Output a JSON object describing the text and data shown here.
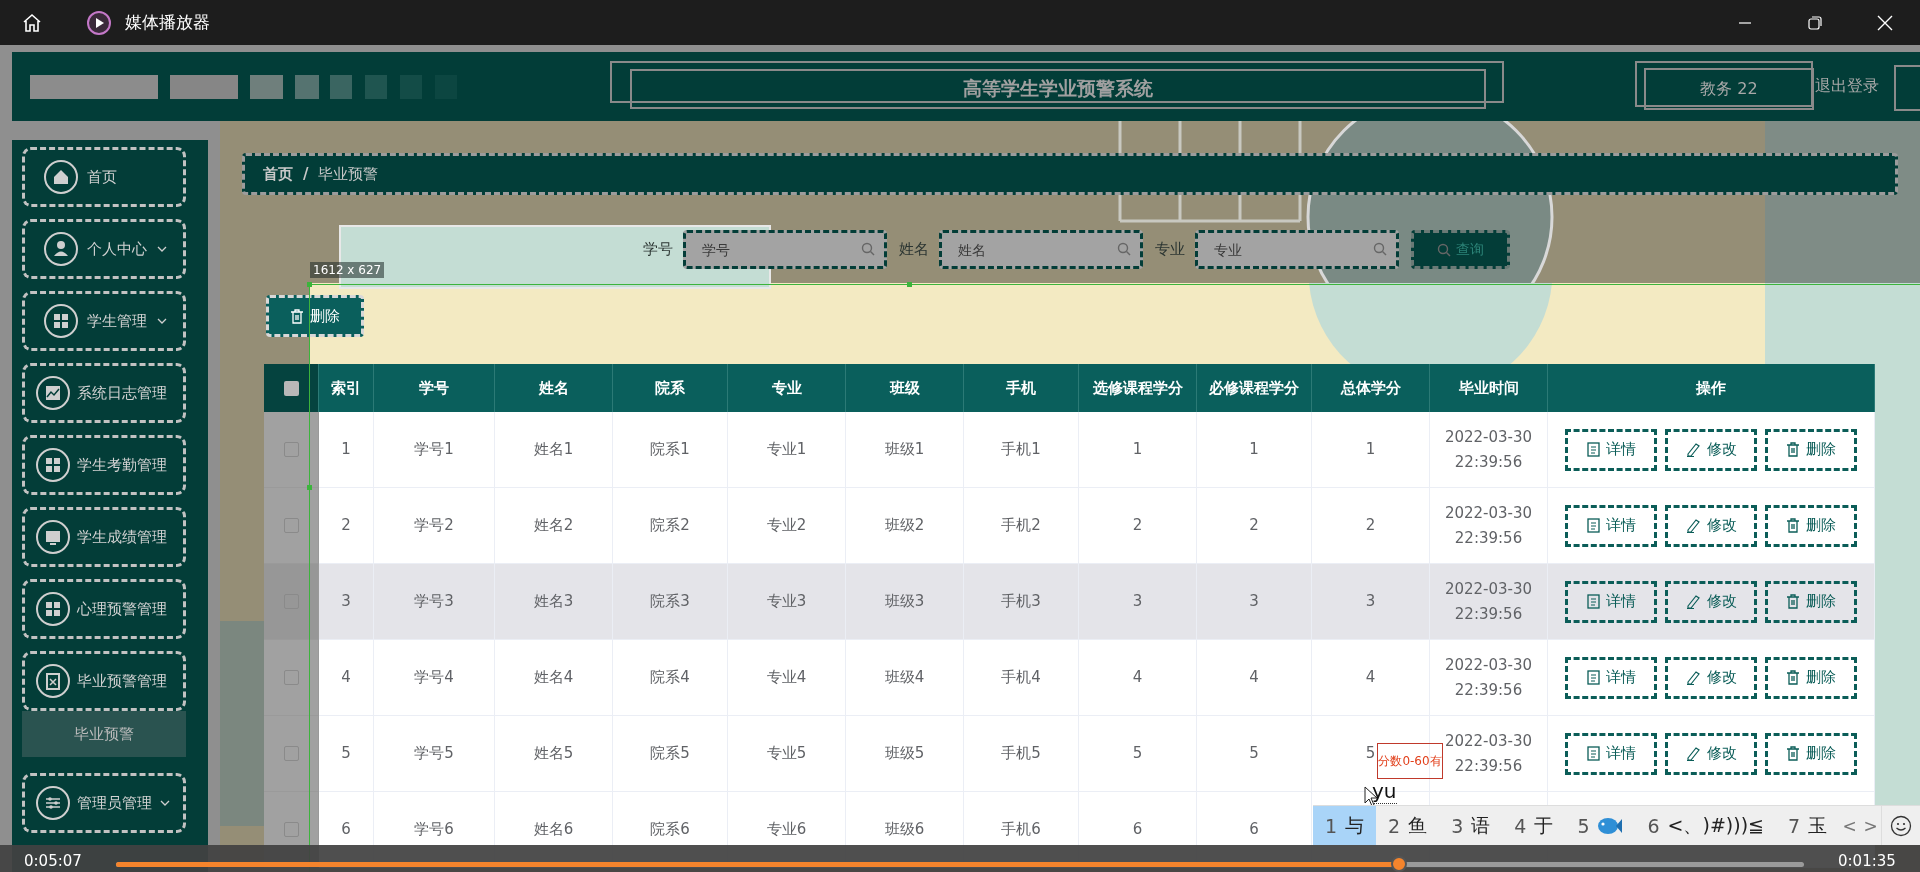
{
  "title_bar": {
    "title": "媒体播放器"
  },
  "header": {
    "title": "高等学生学业预警系统",
    "user": "教务 22",
    "logout": "退出登录"
  },
  "sidebar": {
    "items": [
      {
        "label": "首页",
        "dropdown": false
      },
      {
        "label": "个人中心",
        "dropdown": true
      },
      {
        "label": "学生管理",
        "dropdown": true
      },
      {
        "label": "系统日志管理",
        "dropdown": false
      },
      {
        "label": "学生考勤管理",
        "dropdown": false
      },
      {
        "label": "学生成绩管理",
        "dropdown": false
      },
      {
        "label": "心理预警管理",
        "dropdown": false
      },
      {
        "label": "毕业预警管理",
        "dropdown": false,
        "children": [
          {
            "label": "毕业预警",
            "selected": true
          }
        ]
      },
      {
        "label": "管理员管理",
        "dropdown": true
      }
    ]
  },
  "breadcrumb": {
    "items": [
      "首页",
      "毕业预警"
    ],
    "separator": "/"
  },
  "search": {
    "fields": [
      {
        "label": "学号",
        "placeholder": "学号"
      },
      {
        "label": "姓名",
        "placeholder": "姓名"
      },
      {
        "label": "专业",
        "placeholder": "专业"
      }
    ],
    "button": "查询"
  },
  "delete_button": "删除",
  "selection": {
    "label": "1612 x 627"
  },
  "table": {
    "all_checked": false,
    "columns": [
      "索引",
      "学号",
      "姓名",
      "院系",
      "专业",
      "班级",
      "手机",
      "选修课程学分",
      "必修课程学分",
      "总体学分",
      "毕业时间",
      "操作"
    ],
    "rows": [
      {
        "checked": false,
        "highlighted": false,
        "cells": [
          "1",
          "学号1",
          "姓名1",
          "院系1",
          "专业1",
          "班级1",
          "手机1",
          "1",
          "1",
          "1",
          "2022-03-30 22:39:56"
        ],
        "actions": [
          "详情",
          "修改",
          "删除"
        ]
      },
      {
        "checked": false,
        "highlighted": false,
        "cells": [
          "2",
          "学号2",
          "姓名2",
          "院系2",
          "专业2",
          "班级2",
          "手机2",
          "2",
          "2",
          "2",
          "2022-03-30 22:39:56"
        ],
        "actions": [
          "详情",
          "修改",
          "删除"
        ]
      },
      {
        "checked": false,
        "highlighted": true,
        "cells": [
          "3",
          "学号3",
          "姓名3",
          "院系3",
          "专业3",
          "班级3",
          "手机3",
          "3",
          "3",
          "3",
          "2022-03-30 22:39:56"
        ],
        "actions": [
          "详情",
          "修改",
          "删除"
        ]
      },
      {
        "checked": false,
        "highlighted": false,
        "cells": [
          "4",
          "学号4",
          "姓名4",
          "院系4",
          "专业4",
          "班级4",
          "手机4",
          "4",
          "4",
          "4",
          "2022-03-30 22:39:56"
        ],
        "actions": [
          "详情",
          "修改",
          "删除"
        ]
      },
      {
        "checked": false,
        "highlighted": false,
        "cells": [
          "5",
          "学号5",
          "姓名5",
          "院系5",
          "专业5",
          "班级5",
          "手机5",
          "5",
          "5",
          "5",
          "2022-03-30 22:39:56"
        ],
        "actions": [
          "详情",
          "修改",
          "删除"
        ]
      },
      {
        "checked": false,
        "highlighted": false,
        "cells": [
          "6",
          "学号6",
          "姓名6",
          "院系6",
          "专业6",
          "班级6",
          "手机6",
          "6",
          "6"
        ]
      }
    ]
  },
  "annotation": {
    "text": "分数0-60有"
  },
  "ime": {
    "composition": "yu",
    "candidates": [
      {
        "kind": "text",
        "number": "1",
        "text": "与",
        "selected": true
      },
      {
        "kind": "text",
        "number": "2",
        "text": "鱼",
        "selected": false
      },
      {
        "kind": "text",
        "number": "3",
        "text": "语",
        "selected": false
      },
      {
        "kind": "text",
        "number": "4",
        "text": "于",
        "selected": false
      },
      {
        "kind": "emoji",
        "number": "5",
        "selected": false
      },
      {
        "kind": "text",
        "number": "6",
        "text": "<、)#)))≦",
        "selected": false
      },
      {
        "kind": "text",
        "number": "7",
        "text": "玉",
        "selected": false
      }
    ],
    "prev": "<",
    "next": ">"
  },
  "player": {
    "elapsed": "0:05:07",
    "remaining": "0:01:35",
    "level": 0.76
  }
}
